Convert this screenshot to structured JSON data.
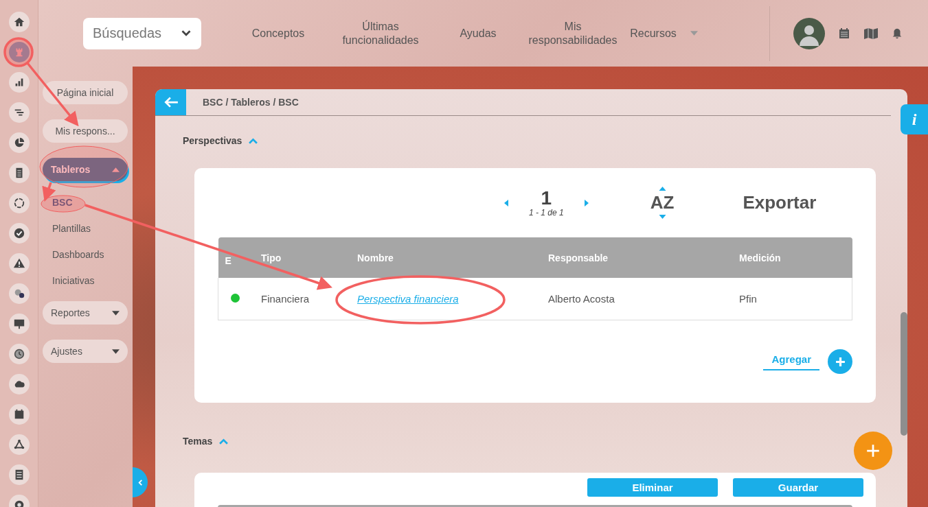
{
  "rail": [
    {
      "selected": false
    },
    {
      "selected": true
    },
    {
      "selected": false
    },
    {
      "selected": false
    },
    {
      "selected": false
    },
    {
      "selected": false
    },
    {
      "selected": false
    },
    {
      "selected": false
    },
    {
      "selected": false
    },
    {
      "selected": false
    },
    {
      "selected": false
    },
    {
      "selected": false
    },
    {
      "selected": false
    },
    {
      "selected": false
    },
    {
      "selected": false
    },
    {
      "selected": false
    },
    {
      "selected": false
    }
  ],
  "topbar": {
    "search": "Búsquedas",
    "nav": [
      {
        "label": "Conceptos",
        "dropdown": false
      },
      {
        "label": "Últimas funcionalidades",
        "dropdown": false
      },
      {
        "label": "Ayudas",
        "dropdown": false
      },
      {
        "label": "Mis responsabilidades",
        "dropdown": false
      },
      {
        "label": "Recursos",
        "dropdown": true
      }
    ]
  },
  "sidebar": {
    "items": [
      {
        "kind": "pill",
        "label": "Página inicial"
      },
      {
        "kind": "pill",
        "label": "Mis respons..."
      },
      {
        "kind": "group",
        "label": "Tableros",
        "expanded": true,
        "children": [
          {
            "label": "BSC",
            "selected": true
          },
          {
            "label": "Plantillas",
            "selected": false
          },
          {
            "label": "Dashboards",
            "selected": false
          },
          {
            "label": "Iniciativas",
            "selected": false
          }
        ]
      },
      {
        "kind": "group",
        "label": "Reportes",
        "expanded": false
      },
      {
        "kind": "group",
        "label": "Ajustes",
        "expanded": false
      }
    ]
  },
  "breadcrumb": "BSC / Tableros / BSC",
  "perspectivas": {
    "title": "Perspectivas",
    "expanded": true,
    "page": "1",
    "page_info": "1 - 1 de 1",
    "sort": "AZ",
    "export": "Exportar",
    "columns": [
      "E",
      "Tipo",
      "Nombre",
      "Responsable",
      "Medición"
    ],
    "rows": [
      {
        "color": "#1ec337",
        "tipo": "Financiera",
        "nombre": "Perspectiva financiera",
        "responsable": "Alberto Acosta",
        "medicion": "Pfin"
      }
    ],
    "add": "Agregar"
  },
  "temas": {
    "title": "Temas",
    "expanded": true,
    "buttons": [
      "Eliminar",
      "Guardar"
    ]
  },
  "info": "i"
}
